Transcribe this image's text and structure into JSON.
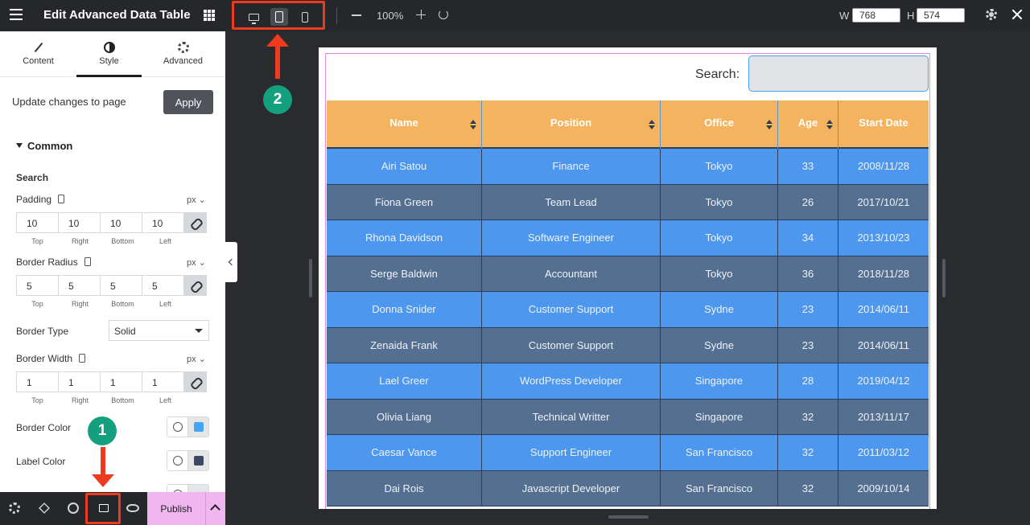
{
  "topbar": {
    "title": "Edit Advanced Data Table",
    "zoom": "100%",
    "width_label": "W",
    "width_value": "768",
    "height_label": "H",
    "height_value": "574",
    "active_device": "tablet"
  },
  "panel": {
    "tabs": [
      {
        "label": "Content",
        "icon": "pencil-icon"
      },
      {
        "label": "Style",
        "icon": "half-circle-icon"
      },
      {
        "label": "Advanced",
        "icon": "gear-icon"
      }
    ],
    "active_tab": "Style",
    "update_text": "Update changes to page",
    "apply_label": "Apply",
    "section_title": "Common",
    "subsection_title": "Search",
    "padding": {
      "label": "Padding",
      "unit": "px",
      "values": [
        "10",
        "10",
        "10",
        "10"
      ]
    },
    "border_radius": {
      "label": "Border Radius",
      "unit": "px",
      "values": [
        "5",
        "5",
        "5",
        "5"
      ]
    },
    "border_width": {
      "label": "Border Width",
      "unit": "px",
      "values": [
        "1",
        "1",
        "1",
        "1"
      ]
    },
    "captions": [
      "Top",
      "Right",
      "Bottom",
      "Left"
    ],
    "border_type": {
      "label": "Border Type",
      "value": "Solid"
    },
    "border_color": {
      "label": "Border Color",
      "color": "#42a5f5"
    },
    "label_color": {
      "label": "Label Color",
      "color": "#3b4a63"
    }
  },
  "bottombar": {
    "publish_label": "Publish"
  },
  "annotations": {
    "badge1": "1",
    "badge2": "2",
    "highlight_color": "#ee3b1f",
    "badge_color": "#14a07e"
  },
  "canvas": {
    "search_label": "Search:",
    "columns": [
      "Name",
      "Position",
      "Office",
      "Age",
      "Start Date"
    ],
    "rows": [
      [
        "Airi Satou",
        "Finance",
        "Tokyo",
        "33",
        "2008/11/28"
      ],
      [
        "Fiona Green",
        "Team Lead",
        "Tokyo",
        "26",
        "2017/10/21"
      ],
      [
        "Rhona Davidson",
        "Software Engineer",
        "Tokyo",
        "34",
        "2013/10/23"
      ],
      [
        "Serge Baldwin",
        "Accountant",
        "Tokyo",
        "36",
        "2018/11/28"
      ],
      [
        "Donna Snider",
        "Customer Support",
        "Sydne",
        "23",
        "2014/06/11"
      ],
      [
        "Zenaida Frank",
        "Customer Support",
        "Sydne",
        "23",
        "2014/06/11"
      ],
      [
        "Lael Greer",
        "WordPress Developer",
        "Singapore",
        "28",
        "2019/04/12"
      ],
      [
        "Olivia Liang",
        "Technical Writter",
        "Singapore",
        "32",
        "2013/11/17"
      ],
      [
        "Caesar Vance",
        "Support Engineer",
        "San Francisco",
        "32",
        "2011/03/12"
      ],
      [
        "Dai Rois",
        "Javascript Developer",
        "San Francisco",
        "32",
        "2009/10/14"
      ]
    ],
    "header_color": "#f4b35e",
    "odd_row_color": "#4e97ef",
    "even_row_color": "#556f90"
  }
}
